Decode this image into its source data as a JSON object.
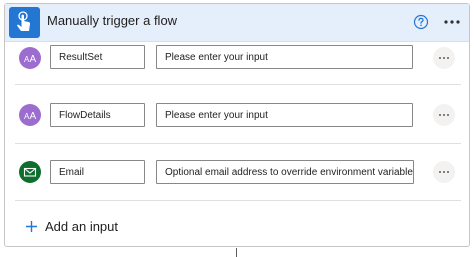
{
  "header": {
    "title": "Manually trigger a flow",
    "trigger_icon": "touch-hand-icon",
    "help_icon": "help-circle-icon",
    "more_icon": "more-horizontal-icon"
  },
  "inputs": [
    {
      "icon": "text-input-icon",
      "name": "ResultSet",
      "placeholder": "Please enter your input",
      "more_icon": "more-horizontal-icon"
    },
    {
      "icon": "text-input-icon",
      "name": "FlowDetails",
      "placeholder": "Please enter your input",
      "more_icon": "more-horizontal-icon"
    },
    {
      "icon": "email-icon",
      "name": "Email",
      "placeholder": "Optional email address to override environment variable",
      "more_icon": "more-horizontal-icon"
    }
  ],
  "add_input": {
    "label": "Add an input",
    "icon": "plus-icon"
  },
  "colors": {
    "header_bg": "#e5eefb",
    "trigger_icon_bg": "#2476d3",
    "text_avatar": "#9c6ccf",
    "email_avatar": "#0f6e2d",
    "accent": "#2476d3"
  }
}
